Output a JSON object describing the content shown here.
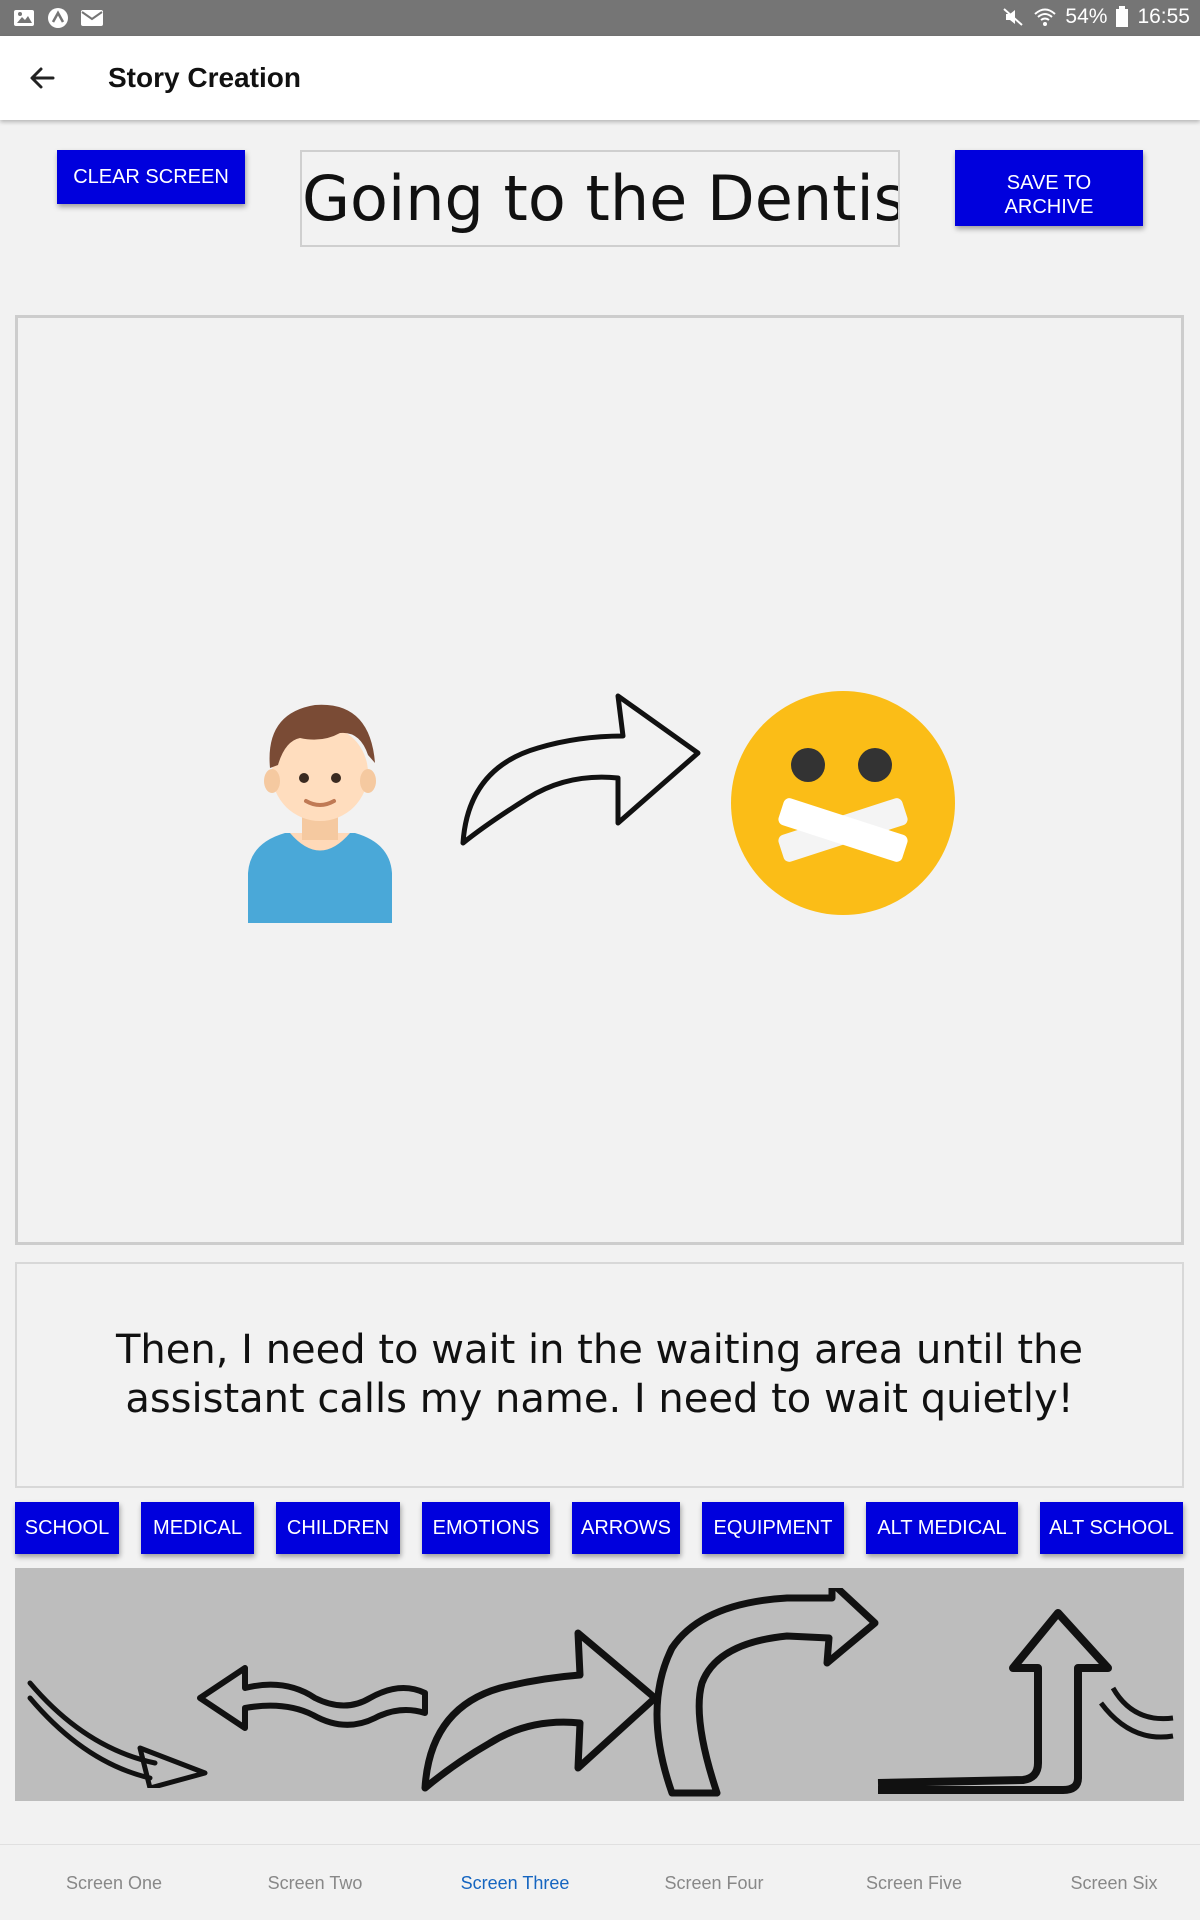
{
  "status_bar": {
    "icons_left": [
      "gallery-icon",
      "app-icon",
      "mail-icon"
    ],
    "icons_right": [
      "mute-icon",
      "wifi-icon",
      "battery-icon"
    ],
    "battery": "54%",
    "time": "16:55"
  },
  "app_bar": {
    "back_icon": "arrow-left-icon",
    "title": "Story Creation"
  },
  "toolbar": {
    "clear_label": "CLEAR SCREEN",
    "save_label": "SAVE TO\nARCHIVE",
    "accent_color": "#0000dd"
  },
  "story": {
    "title": "Going to the Dentist",
    "caption": "Then, I need to wait in the waiting area until the assistant calls my name. I need to wait quietly!"
  },
  "canvas": {
    "items": [
      "boy-icon",
      "curved-arrow-icon",
      "quiet-face-icon"
    ]
  },
  "categories": [
    "SCHOOL",
    "MEDICAL",
    "CHILDREN",
    "EMOTIONS",
    "ARROWS",
    "EQUIPMENT",
    "ALT MEDICAL",
    "ALT SCHOOL"
  ],
  "palette": {
    "items": [
      "arrow-down-right-icon",
      "wavy-arrow-left-icon",
      "curved-arrow-right-icon",
      "u-turn-arrow-icon",
      "corner-arrow-up-icon"
    ]
  },
  "bottom_nav": {
    "tabs": [
      "Screen One",
      "Screen Two",
      "Screen Three",
      "Screen Four",
      "Screen Five",
      "Screen Six"
    ],
    "active_index": 2,
    "active_color": "#1565c0"
  }
}
